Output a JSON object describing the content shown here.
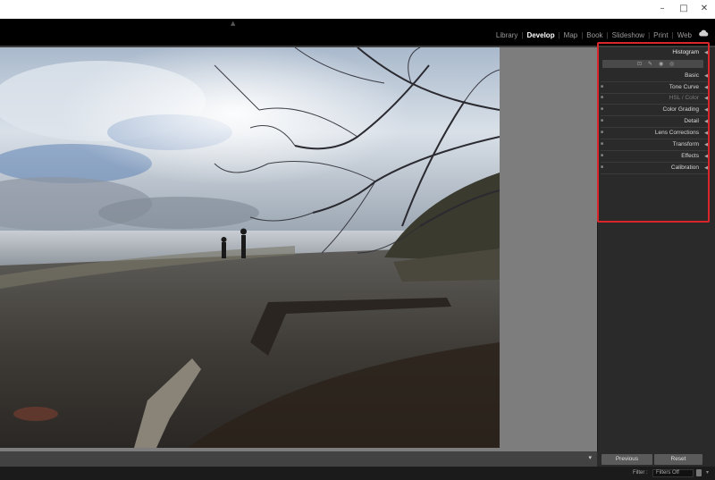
{
  "window": {
    "minimize": "–",
    "maximize": "□",
    "close": "✕"
  },
  "modules": [
    "Library",
    "Develop",
    "Map",
    "Book",
    "Slideshow",
    "Print",
    "Web"
  ],
  "active_module": "Develop",
  "panels": {
    "histogram": "Histogram",
    "items": [
      "Basic",
      "Tone Curve",
      "HSL / Color",
      "Color Grading",
      "Detail",
      "Lens Corrections",
      "Transform",
      "Effects",
      "Calibration"
    ]
  },
  "buttons": {
    "previous": "Previous",
    "reset": "Reset"
  },
  "filter": {
    "label": "Filter :",
    "value": "Filters Off"
  },
  "colors": {
    "highlight": "#d9262b",
    "panel_bg": "#2a2a2a",
    "viewer_bg": "#7d7d7d"
  },
  "icons": [
    "cloud-sync-icon",
    "crop-tool-icon",
    "spot-removal-icon",
    "red-eye-icon",
    "masking-icon",
    "disclosure-triangle-icon",
    "panel-switch-icon"
  ]
}
